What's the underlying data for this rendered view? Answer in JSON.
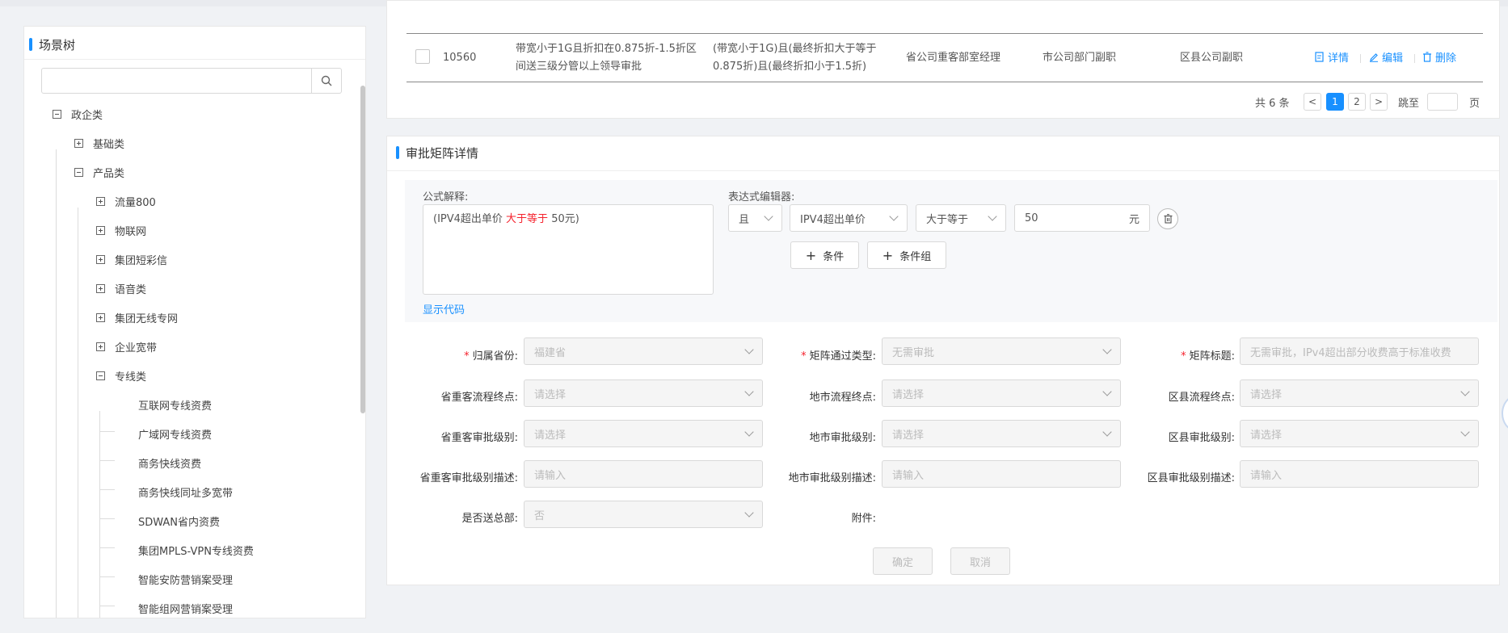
{
  "tree": {
    "title": "场景树",
    "search_placeholder": "",
    "nodes": [
      {
        "label": "政企类",
        "toggle": "minus"
      },
      {
        "label": "基础类",
        "toggle": "plus"
      },
      {
        "label": "产品类",
        "toggle": "minus"
      },
      {
        "label": "流量800",
        "toggle": "plus"
      },
      {
        "label": "物联网",
        "toggle": "plus"
      },
      {
        "label": "集团短彩信",
        "toggle": "plus"
      },
      {
        "label": "语音类",
        "toggle": "plus"
      },
      {
        "label": "集团无线专网",
        "toggle": "plus"
      },
      {
        "label": "企业宽带",
        "toggle": "plus"
      },
      {
        "label": "专线类",
        "toggle": "minus"
      },
      {
        "label": "互联网专线资费",
        "toggle": "none"
      },
      {
        "label": "广域网专线资费",
        "toggle": "none"
      },
      {
        "label": "商务快线资费",
        "toggle": "none"
      },
      {
        "label": "商务快线同址多宽带",
        "toggle": "none"
      },
      {
        "label": "SDWAN省内资费",
        "toggle": "none"
      },
      {
        "label": "集团MPLS-VPN专线资费",
        "toggle": "none"
      },
      {
        "label": "智能安防营销案受理",
        "toggle": "none"
      },
      {
        "label": "智能组网营销案受理",
        "toggle": "none"
      }
    ]
  },
  "table": {
    "row": {
      "id": "10560",
      "desc_line1": "带宽小于1G且折扣在0.875折-1.5折区",
      "desc_line2": "间送三级分管以上领导审批",
      "cond_line1": "(带宽小于1G)且(最终折扣大于等于",
      "cond_line2": "0.875折)且(最终折扣小于1.5折)",
      "province": "省公司重客部室经理",
      "city": "市公司部门副职",
      "county": "区县公司副职",
      "op_detail": "详情",
      "op_edit": "编辑",
      "op_delete": "删除"
    },
    "pagination": {
      "total_text": "共 6 条",
      "prev": "<",
      "next": ">",
      "pages": [
        "1",
        "2"
      ],
      "current_page": 1,
      "jump_label": "跳至",
      "page_unit": "页"
    }
  },
  "detail": {
    "title": "审批矩阵详情",
    "formula_label": "公式解释:",
    "formula_pre": "(IPV4超出单价 ",
    "formula_op": "大于等于",
    "formula_post": " 50元)",
    "show_code": "显示代码",
    "editor_label": "表达式编辑器:",
    "logic_value": "且",
    "field_value": "IPV4超出单价",
    "operator_value": "大于等于",
    "number_value": "50",
    "unit": "元",
    "add_condition": "条件",
    "add_group": "条件组",
    "fields": {
      "province": {
        "label": "归属省份:",
        "value": "福建省"
      },
      "pass_type": {
        "label": "矩阵通过类型:",
        "value": "无需审批"
      },
      "matrix_title": {
        "label": "矩阵标题:",
        "value": "无需审批，IPv4超出部分收费高于标准收费"
      },
      "prov_end": {
        "label": "省重客流程终点:",
        "placeholder": "请选择"
      },
      "city_end": {
        "label": "地市流程终点:",
        "placeholder": "请选择"
      },
      "county_end": {
        "label": "区县流程终点:",
        "placeholder": "请选择"
      },
      "prov_level": {
        "label": "省重客审批级别:",
        "placeholder": "请选择"
      },
      "city_level": {
        "label": "地市审批级别:",
        "placeholder": "请选择"
      },
      "county_level": {
        "label": "区县审批级别:",
        "placeholder": "请选择"
      },
      "prov_level_desc": {
        "label": "省重客审批级别描述:",
        "placeholder": "请输入"
      },
      "city_level_desc": {
        "label": "地市审批级别描述:",
        "placeholder": "请输入"
      },
      "county_level_desc": {
        "label": "区县审批级别描述:",
        "placeholder": "请输入"
      },
      "send_hq": {
        "label": "是否送总部:",
        "value": "否"
      },
      "attachment": {
        "label": "附件:"
      }
    },
    "confirm": "确定",
    "cancel": "取消"
  },
  "colors": {
    "accent": "#1890ff",
    "required": "#f5222d"
  }
}
